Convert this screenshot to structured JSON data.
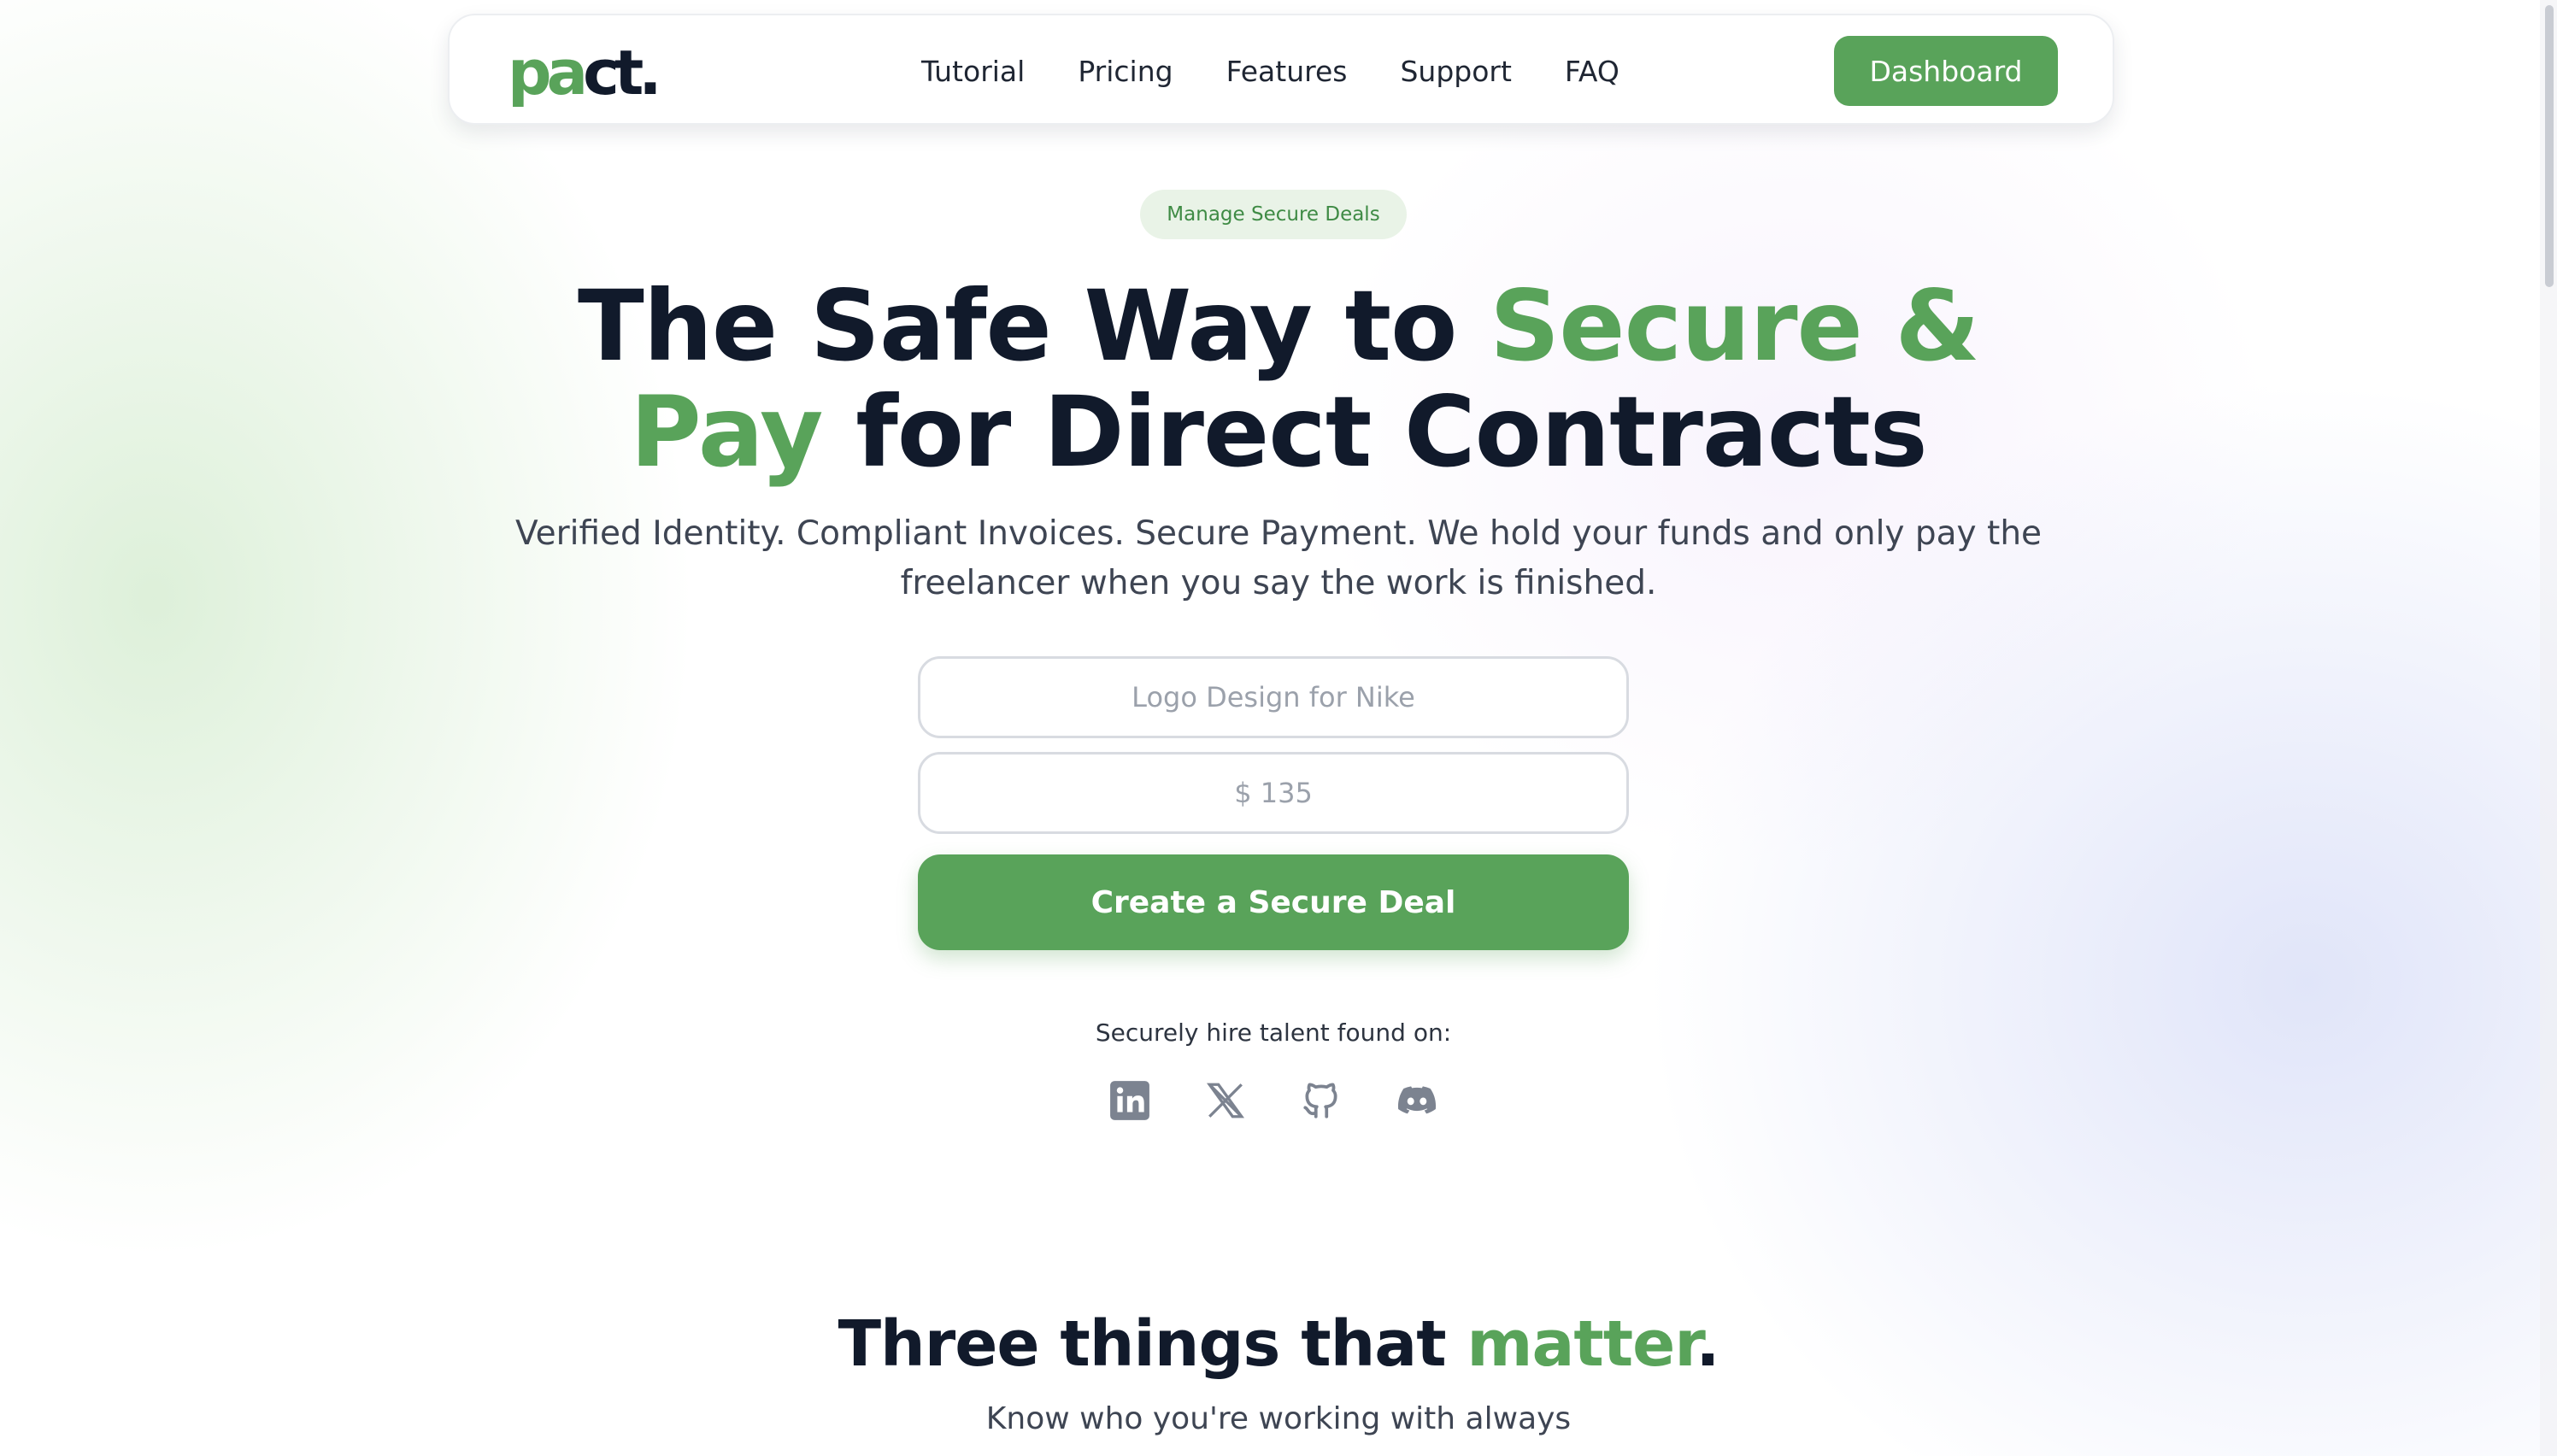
{
  "colors": {
    "brand_green": "#59a35a",
    "dark_text": "#111a2b",
    "badge_bg": "#e9f3e7",
    "muted_icon": "#7c8390"
  },
  "logo": {
    "part1": "pa",
    "part2": "c",
    "part3": "t."
  },
  "nav": {
    "links": [
      "Tutorial",
      "Pricing",
      "Features",
      "Support",
      "FAQ"
    ],
    "dashboard_label": "Dashboard"
  },
  "hero": {
    "badge": "Manage Secure Deals",
    "headline": {
      "line1_dark": "The Safe Way to ",
      "line1_green": "Secure &",
      "line2_green": "Pay",
      "line2_dark": " for Direct Contracts"
    },
    "subheadline": "Verified Identity. Compliant Invoices. Secure Payment. We hold your funds and only pay the freelancer when you say the work is finished.",
    "form": {
      "title_placeholder": "Logo Design for Nike",
      "title_value": "",
      "price_placeholder": "$ 135",
      "price_value": "",
      "submit_label": "Create a Secure Deal"
    },
    "hire_label": "Securely hire talent found on:",
    "social_icons": [
      "linkedin-icon",
      "x-icon",
      "github-icon",
      "discord-icon"
    ]
  },
  "section": {
    "title_dark": "Three things that ",
    "title_green": "matter",
    "title_end": ".",
    "subtitle": "Know who you're working with always"
  }
}
